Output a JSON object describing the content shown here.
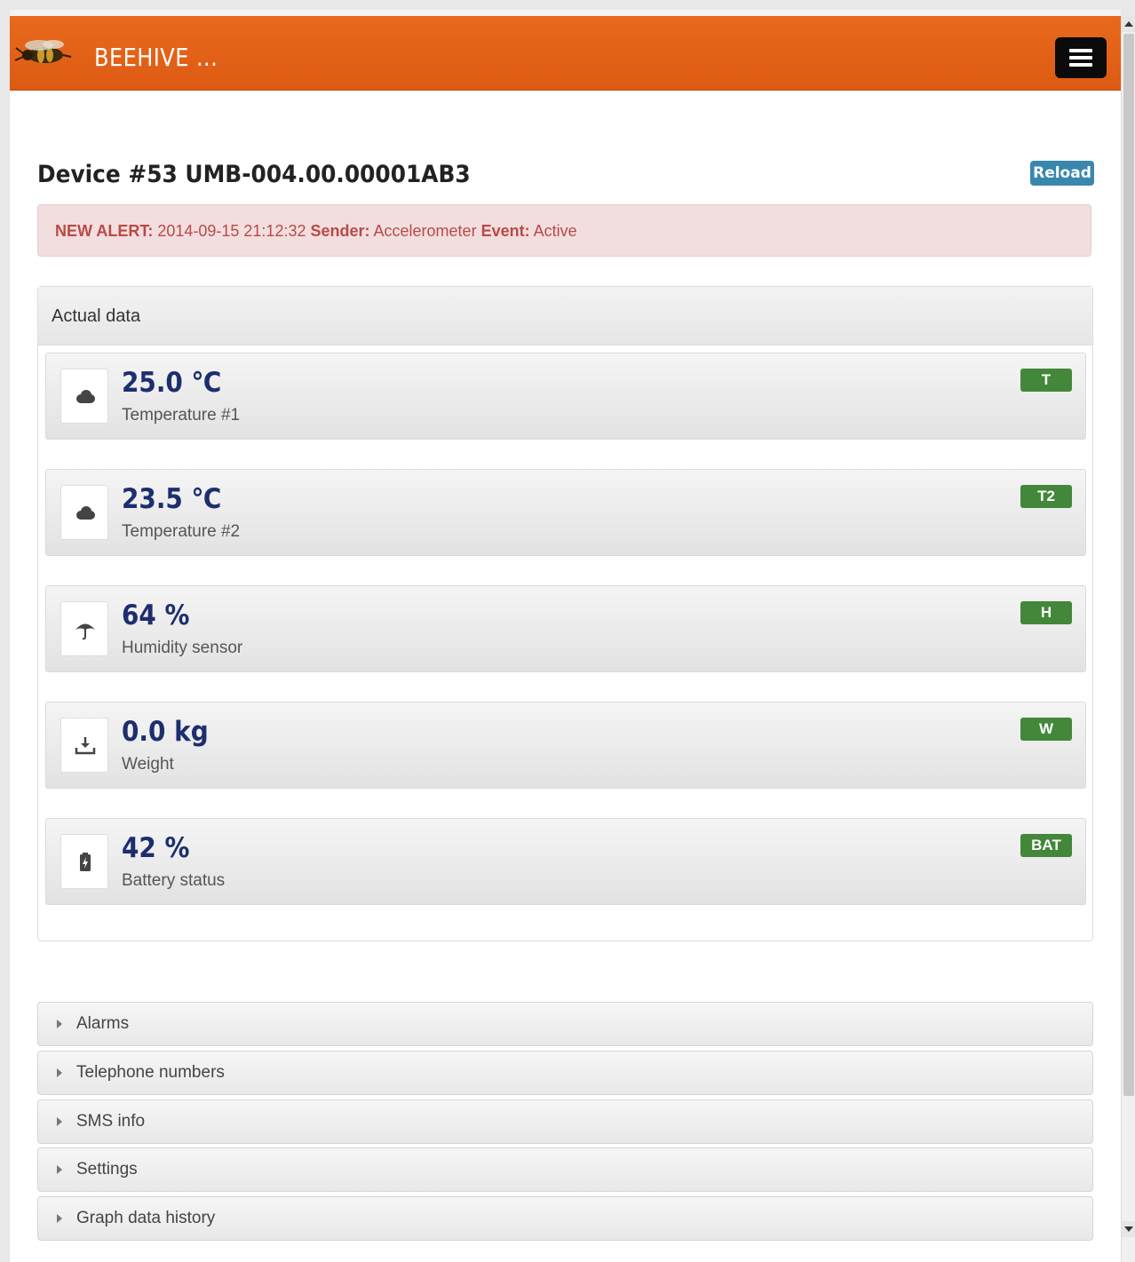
{
  "header": {
    "brand": "BEEHIVE ...",
    "logo_icon": "bee-icon",
    "menu_icon": "hamburger-menu-icon"
  },
  "device": {
    "title": "Device #53 UMB-004.00.00001AB3",
    "reload_label": "Reload"
  },
  "alert": {
    "prefix": "NEW ALERT:",
    "timestamp": " 2014-09-15 21:12:32 ",
    "sender_label": "Sender:",
    "sender_value": " Accelerometer ",
    "event_label": "Event:",
    "event_value": " Active"
  },
  "panel": {
    "title": "Actual data",
    "sensors": [
      {
        "value": "25.0 ℃",
        "label": "Temperature #1",
        "badge": "T",
        "icon": "cloud-icon"
      },
      {
        "value": "23.5 ℃",
        "label": "Temperature #2",
        "badge": "T2",
        "icon": "cloud-icon"
      },
      {
        "value": "64 %",
        "label": "Humidity sensor",
        "badge": "H",
        "icon": "umbrella-icon"
      },
      {
        "value": "0.0 kg",
        "label": "Weight",
        "badge": "W",
        "icon": "download-tray-icon"
      },
      {
        "value": "42 %",
        "label": "Battery status",
        "badge": "BAT",
        "icon": "battery-charging-icon"
      }
    ]
  },
  "accordion": [
    {
      "label": "Alarms"
    },
    {
      "label": "Telephone numbers"
    },
    {
      "label": "SMS info"
    },
    {
      "label": "Settings"
    },
    {
      "label": "Graph data history"
    }
  ],
  "colors": {
    "header_orange": "#e2611a",
    "value_blue": "#1c2e6e",
    "badge_green": "#43873a",
    "alert_text": "#b94a48",
    "alert_bg": "#f2dede",
    "reload_blue": "#3a87ad"
  }
}
